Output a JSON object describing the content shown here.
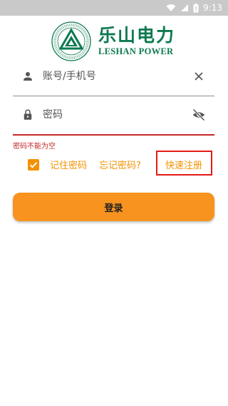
{
  "status_bar": {
    "time": "9:13",
    "icons": [
      "wifi-icon",
      "signal-icon",
      "battery-icon"
    ],
    "background": "#c9c9c9"
  },
  "logo": {
    "cn_name": "乐山电力",
    "en_name": "LESHAN POWER",
    "ring_text": "乐山电力股份有限公司 LESHAN ELECTRIC POWER CO.,LTD",
    "color": "#0d7a4f"
  },
  "form": {
    "account": {
      "icon": "person-icon",
      "placeholder": "账号/手机号",
      "action_icon": "clear-icon"
    },
    "password": {
      "icon": "lock-icon",
      "placeholder": "密码",
      "action_icon": "visibility-off-icon",
      "error": "密码不能为空"
    },
    "remember_label": "记住密码",
    "remember_checked": true,
    "forgot_label": "忘记密码?",
    "register_label": "快速注册",
    "login_label": "登录"
  },
  "colors": {
    "accent": "#f39200",
    "button": "#f7931e",
    "error": "#c62828",
    "highlight_box": "#e41b17"
  }
}
